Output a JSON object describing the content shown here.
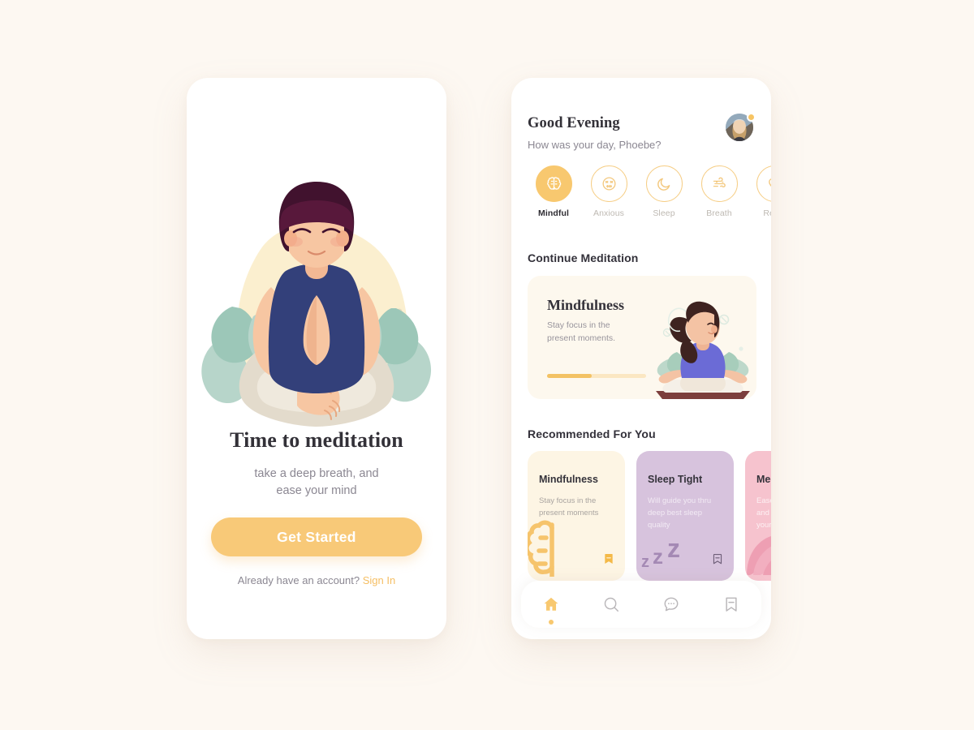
{
  "theme": {
    "background": "#FDF8F2",
    "accent": "#F8C86F",
    "accent_deep": "#F3C264",
    "card_cream": "#FDF5E4",
    "card_purple": "#D7C3DD",
    "card_pink": "#F6C3CE",
    "text_dark": "#33313A",
    "text_muted": "#8B8792"
  },
  "onboarding": {
    "illustration_name": "woman-meditating-lotus-illustration",
    "title": "Time to meditation",
    "subtitle_line1": "take a deep breath, and",
    "subtitle_line2": "ease your mind",
    "cta_label": "Get Started",
    "footer_prefix": "Already have an account?",
    "footer_link": "Sign In"
  },
  "home": {
    "greeting": "Good Evening",
    "subgreeting": "How was your day, Phoebe?",
    "avatar_name": "user-avatar",
    "has_notification": true,
    "moods": [
      {
        "label": "Mindful",
        "icon": "brain-icon",
        "active": true
      },
      {
        "label": "Anxious",
        "icon": "anxious-face-icon",
        "active": false
      },
      {
        "label": "Sleep",
        "icon": "moon-icon",
        "active": false
      },
      {
        "label": "Breath",
        "icon": "wind-icon",
        "active": false
      },
      {
        "label": "Relax",
        "icon": "heart-icon",
        "active": false
      }
    ],
    "continue_section_title": "Continue Meditation",
    "continue_card": {
      "title": "Mindfulness",
      "subtitle_line1": "Stay focus in the",
      "subtitle_line2": "present moments.",
      "progress_percent": 45,
      "illustration_name": "woman-meditating-card-illustration"
    },
    "recommended_section_title": "Recommended For You",
    "recommended": [
      {
        "title": "Mindfulness",
        "desc_line1": "Stay focus in the",
        "desc_line2": "present moments",
        "art": "brain-icon",
        "bookmarked": true
      },
      {
        "title": "Sleep Tight",
        "desc_line1": "Will guide you thru",
        "desc_line2": "deep best sleep",
        "desc_line3": "quality",
        "art": "zzz-icon",
        "bookmarked": false
      },
      {
        "title": "Meditation",
        "desc_line1": "Ease your mind",
        "desc_line2": "and relieve",
        "desc_line3": "your stress",
        "art": "lotus-petals-icon",
        "bookmarked": false
      }
    ],
    "nav": [
      {
        "icon": "home-icon",
        "active": true
      },
      {
        "icon": "search-icon",
        "active": false
      },
      {
        "icon": "chat-bubble-icon",
        "active": false
      },
      {
        "icon": "bookmark-icon",
        "active": false
      }
    ]
  }
}
